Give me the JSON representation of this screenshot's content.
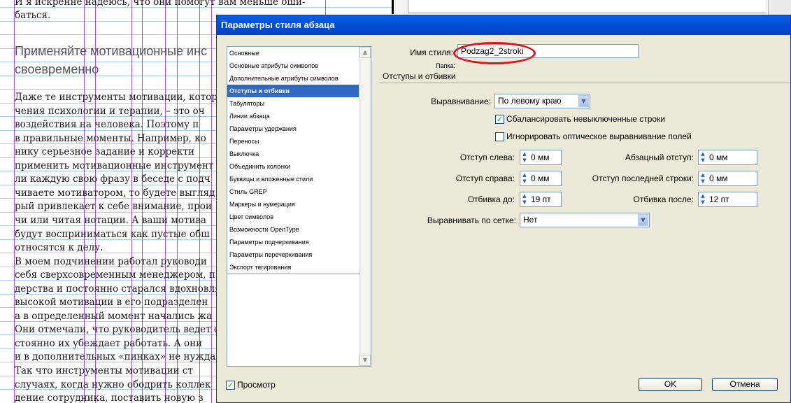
{
  "document": {
    "lines_top": [
      "И я искренне надеюсь, что они помогут вам меньше оши-",
      "баться."
    ],
    "heading": [
      "Применяйте мотивационные инс",
      "своевременно"
    ],
    "body_lines": [
      "Даже те инструменты мотивации, котор",
      "чения психологии и терапии, – это оч",
      "воздействия на человека. Поэтому п",
      "в правильные моменты. Например, ко",
      "нику серьезное задание и корректи",
      "применить мотивационные инструмент",
      "ли каждую свою фразу в беседе с подч",
      "чиваете мотиватором, то будете выгляд",
      "рый привлекает к себе внимание, прои",
      "чи или читая нотации. А ваши мотива",
      "будут восприниматься как пустые обш",
      "относятся к делу.",
      "    В моем подчинении работал руководи",
      "себя сверхсовременным менеджером, п",
      "дерства и постоянно старался вдохновля",
      "высокой мотивации в его подразделен",
      "а в определенный момент начались жа",
      "Они отмечали, что руководитель ведет се",
      "стоянно их убеждает работать. А они",
      "и в дополнительных «пинках» не нуждал",
      "    Так что инструменты мотивации ст",
      "случаях, когда нужно ободрить коллек",
      "дение сотрудника, поставить новую з"
    ]
  },
  "dialog": {
    "title": "Параметры стиля абзаца",
    "categories": [
      "Основные",
      "Основные атрибуты символов",
      "Дополнительные атрибуты символов",
      "Отступы и отбивки",
      "Табуляторы",
      "Линии абзаца",
      "Параметры удержания",
      "Переносы",
      "Выключка",
      "Объединить колонки",
      "Буквицы и вложенные стили",
      "Стиль GREP",
      "Маркеры и нумерация",
      "Цвет символов",
      "Возможности OpenType",
      "Параметры подчеркивания",
      "Параметры перечеркивания",
      "Экспорт тегирования"
    ],
    "selected_category_index": 3,
    "style_name_label": "Имя стиля:",
    "style_name_value": "Podzag2_2stroki",
    "folder_label": "Папка:",
    "section_title": "Отступы и отбивки",
    "alignment_label": "Выравнивание:",
    "alignment_value": "По левому краю",
    "balance_label": "Сбалансировать невыключенные строки",
    "balance_checked": true,
    "ignore_optical_label": "Игнорировать оптическое выравнивание полей",
    "ignore_optical_checked": false,
    "left_indent_label": "Отступ слева:",
    "left_indent_value": "0 мм",
    "first_line_indent_label": "Абзацный отступ:",
    "first_line_indent_value": "0 мм",
    "right_indent_label": "Отступ справа:",
    "right_indent_value": "0 мм",
    "last_line_indent_label": "Отступ последней строки:",
    "last_line_indent_value": "0 мм",
    "space_before_label": "Отбивка до:",
    "space_before_value": "19 пт",
    "space_after_label": "Отбивка после:",
    "space_after_value": "12 пт",
    "align_grid_label": "Выравнивать по сетке:",
    "align_grid_value": "Нет",
    "preview_label": "Просмотр",
    "preview_checked": true,
    "ok_label": "OK",
    "cancel_label": "Отмена"
  },
  "colors": {
    "titlebar": "#0552d6",
    "selection": "#316ac5",
    "dialog_bg": "#ece9d8",
    "annotation": "#e0141e",
    "guide": "#8a2be2",
    "baseline": "#7fb0ff"
  }
}
